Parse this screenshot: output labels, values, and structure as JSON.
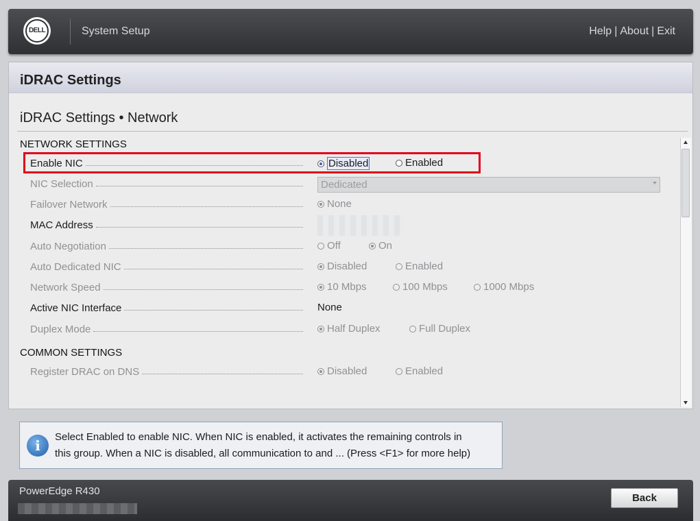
{
  "header": {
    "logo_text": "DELL",
    "app_title": "System Setup",
    "links": [
      "Help",
      "About",
      "Exit"
    ]
  },
  "panel": {
    "title": "iDRAC Settings",
    "subtitle": "iDRAC Settings • Network"
  },
  "sections": {
    "network": "NETWORK SETTINGS",
    "common": "COMMON SETTINGS"
  },
  "rows": {
    "enable_nic": {
      "label": "Enable NIC",
      "options": [
        "Disabled",
        "Enabled"
      ],
      "selected": "Disabled"
    },
    "nic_selection": {
      "label": "NIC Selection",
      "value": "Dedicated"
    },
    "failover": {
      "label": "Failover Network",
      "options": [
        "None"
      ],
      "selected": "None"
    },
    "mac": {
      "label": "MAC Address"
    },
    "auto_neg": {
      "label": "Auto Negotiation",
      "options": [
        "Off",
        "On"
      ],
      "selected": "On"
    },
    "auto_ded": {
      "label": "Auto Dedicated NIC",
      "options": [
        "Disabled",
        "Enabled"
      ],
      "selected": "Disabled"
    },
    "speed": {
      "label": "Network Speed",
      "options": [
        "10 Mbps",
        "100 Mbps",
        "1000 Mbps"
      ],
      "selected": "10 Mbps"
    },
    "active_nic": {
      "label": "Active NIC Interface",
      "value": "None"
    },
    "duplex": {
      "label": "Duplex Mode",
      "options": [
        "Half Duplex",
        "Full Duplex"
      ],
      "selected": "Half Duplex"
    },
    "register_dns": {
      "label": "Register DRAC on DNS",
      "options": [
        "Disabled",
        "Enabled"
      ],
      "selected": "Disabled"
    }
  },
  "info": {
    "icon": "i",
    "line1": "Select Enabled to enable NIC. When NIC is enabled, it activates the remaining controls in",
    "line2": "this group. When a NIC is disabled, all communication to and ... (Press <F1> for more help)"
  },
  "footer": {
    "model": "PowerEdge R430",
    "back_label": "Back"
  },
  "colors": {
    "highlight": "#e0001b",
    "radio_selected": "#3561c4"
  }
}
